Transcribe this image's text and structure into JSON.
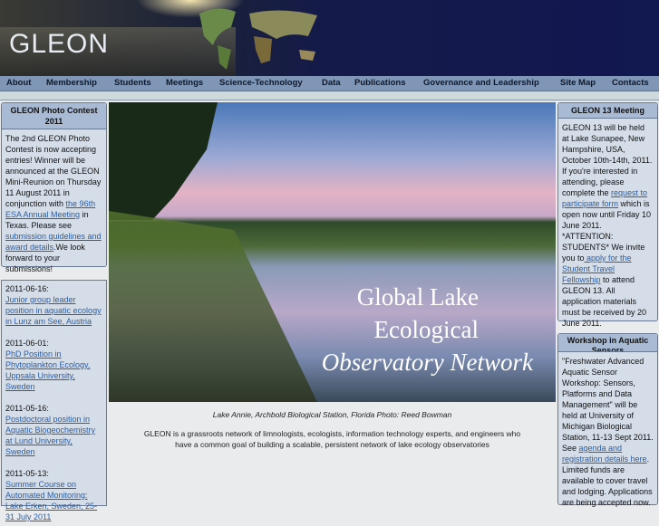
{
  "header": {
    "logo": "GLEON"
  },
  "nav": [
    "About",
    "Membership",
    "Students",
    "Meetings",
    "Science-Technology",
    "Data",
    "Publications",
    "Governance and Leadership",
    "Site Map",
    "Contacts"
  ],
  "left": {
    "contest": {
      "title": "GLEON Photo Contest 2011",
      "t1": "The 2nd GLEON Photo Contest is now accepting entries! Winner will be announced at the GLEON Mini-Reunion on Thursday 11 August 2011 in conjunction with ",
      "l1": "the 96th ESA Annual Meeting",
      "t2": " in Texas. Please see ",
      "l2": "submission guidelines and award details",
      "t3": ".We look forward to your submissions!"
    },
    "news": [
      {
        "date": "2011-06-16:",
        "link": "Junior group leader position in aquatic ecology in Lunz am See, Austria"
      },
      {
        "date": "2011-06-01:",
        "link": "PhD Position in Phytoplankton Ecology, Uppsala University, Sweden"
      },
      {
        "date": "2011-05-16:",
        "link": "Postdoctoral position in Aquatic Biogeochemistry at Lund University, Sweden"
      },
      {
        "date": "2011-05-13:",
        "link": "Summer Course on Automated Monitoring: Lake Erken, Sweden, 25-31 July 2011"
      }
    ]
  },
  "photo": {
    "line1": "Global Lake",
    "line2": "Ecological",
    "line3": "Observatory Network"
  },
  "caption": "Lake Annie, Archbold Biological Station, Florida  Photo: Reed Bowman",
  "description": "GLEON is a grassroots network of limnologists, ecologists, information technology experts, and engineers who have a common goal of building a scalable, persistent network of lake ecology observatories",
  "right": {
    "meeting": {
      "title": "GLEON 13 Meeting",
      "t1": "GLEON 13 will be held at Lake Sunapee, New Hampshire, USA, October 10th-14th, 2011. If you're interested in attending, please complete the ",
      "l1": "request to participate form",
      "t2": " which is open now until Friday 10 June 2011. *ATTENTION: STUDENTS* We invite you to",
      "l2": " apply for the Student Travel Fellowship",
      "t3": " to attend GLEON 13. All application materials must be received by 20 June 2011."
    },
    "workshop": {
      "title": "Workshop in Aquatic Sensors",
      "t1": "\"Freshwater Advanced Aquatic Sensor Workshop: Sensors, Platforms and Data Management\" will be held at University of Michigan Biological Station, 11-13 Sept 2011. See ",
      "l1": "agenda and registration details here",
      "t2": ". Limited funds are available to cover travel and lodging. Applications are being accepted now."
    }
  }
}
